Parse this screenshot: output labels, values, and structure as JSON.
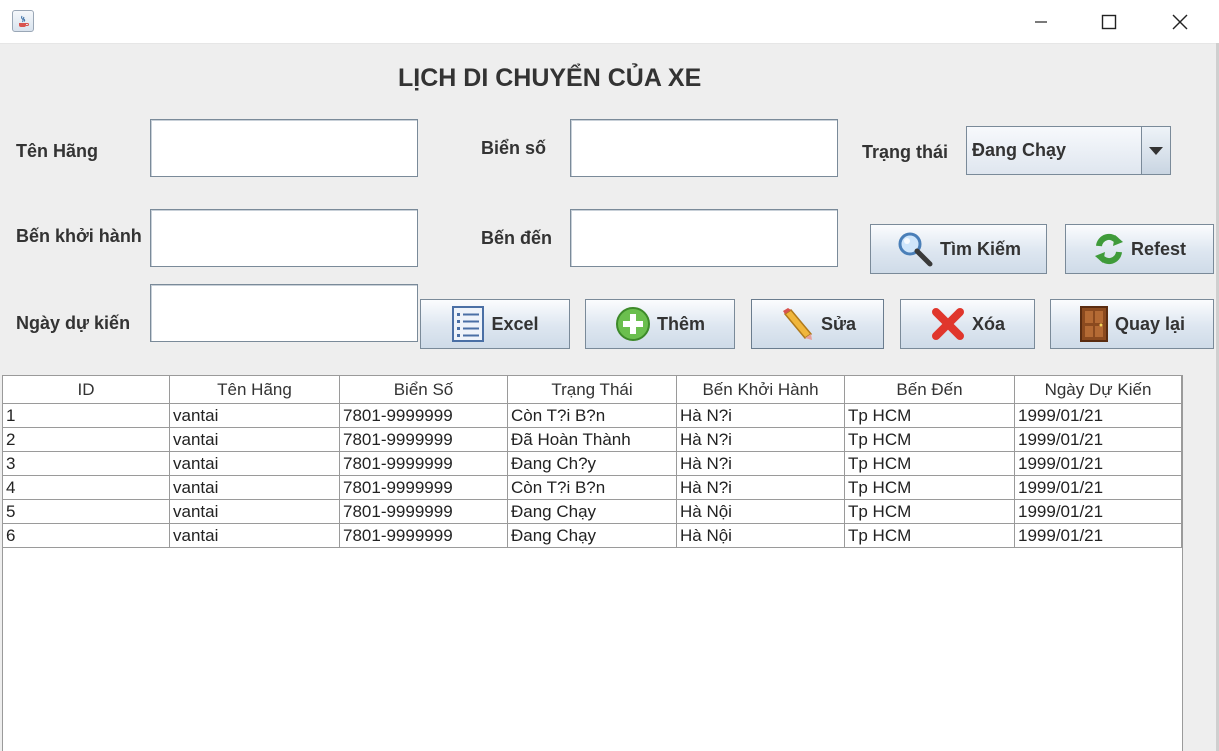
{
  "window": {
    "title": "",
    "min_icon": "minimize-icon",
    "max_icon": "maximize-icon",
    "close_icon": "close-icon"
  },
  "page_title": "LỊCH DI CHUYỂN CỦA XE",
  "form": {
    "ten_hang_label": "Tên Hãng",
    "bien_so_label": "Biển số",
    "trang_thai_label": "Trạng thái",
    "ben_khoi_hanh_label": "Bến khởi hành",
    "ben_den_label": "Bến đến",
    "ngay_du_kien_label": "Ngày dự kiến",
    "trang_thai_value": "Đang Chạy"
  },
  "buttons": {
    "search": "Tìm Kiếm",
    "refresh": "Refest",
    "excel": "Excel",
    "add": "Thêm",
    "edit": "Sửa",
    "delete": "Xóa",
    "back": "Quay lại"
  },
  "table": {
    "columns": [
      "ID",
      "Tên Hãng",
      "Biển Số",
      "Trạng Thái",
      "Bến Khởi Hành",
      "Bến Đến",
      "Ngày Dự Kiến"
    ],
    "rows": [
      [
        "1",
        "vantai",
        "7801-9999999",
        "Còn T?i B?n",
        "Hà N?i",
        "Tp HCM",
        "1999/01/21"
      ],
      [
        "2",
        "vantai",
        "7801-9999999",
        "Đã Hoàn Thành",
        "Hà N?i",
        "Tp HCM",
        "1999/01/21"
      ],
      [
        "3",
        "vantai",
        "7801-9999999",
        "Đang Ch?y",
        "Hà N?i",
        "Tp HCM",
        "1999/01/21"
      ],
      [
        "4",
        "vantai",
        "7801-9999999",
        "Còn T?i B?n",
        "Hà N?i",
        "Tp HCM",
        "1999/01/21"
      ],
      [
        "5",
        "vantai",
        "7801-9999999",
        "Đang Chạy",
        "Hà Nội",
        "Tp HCM",
        "1999/01/21"
      ],
      [
        "6",
        "vantai",
        "7801-9999999",
        "Đang Chạy",
        "Hà Nội",
        "Tp HCM",
        "1999/01/21"
      ]
    ]
  }
}
